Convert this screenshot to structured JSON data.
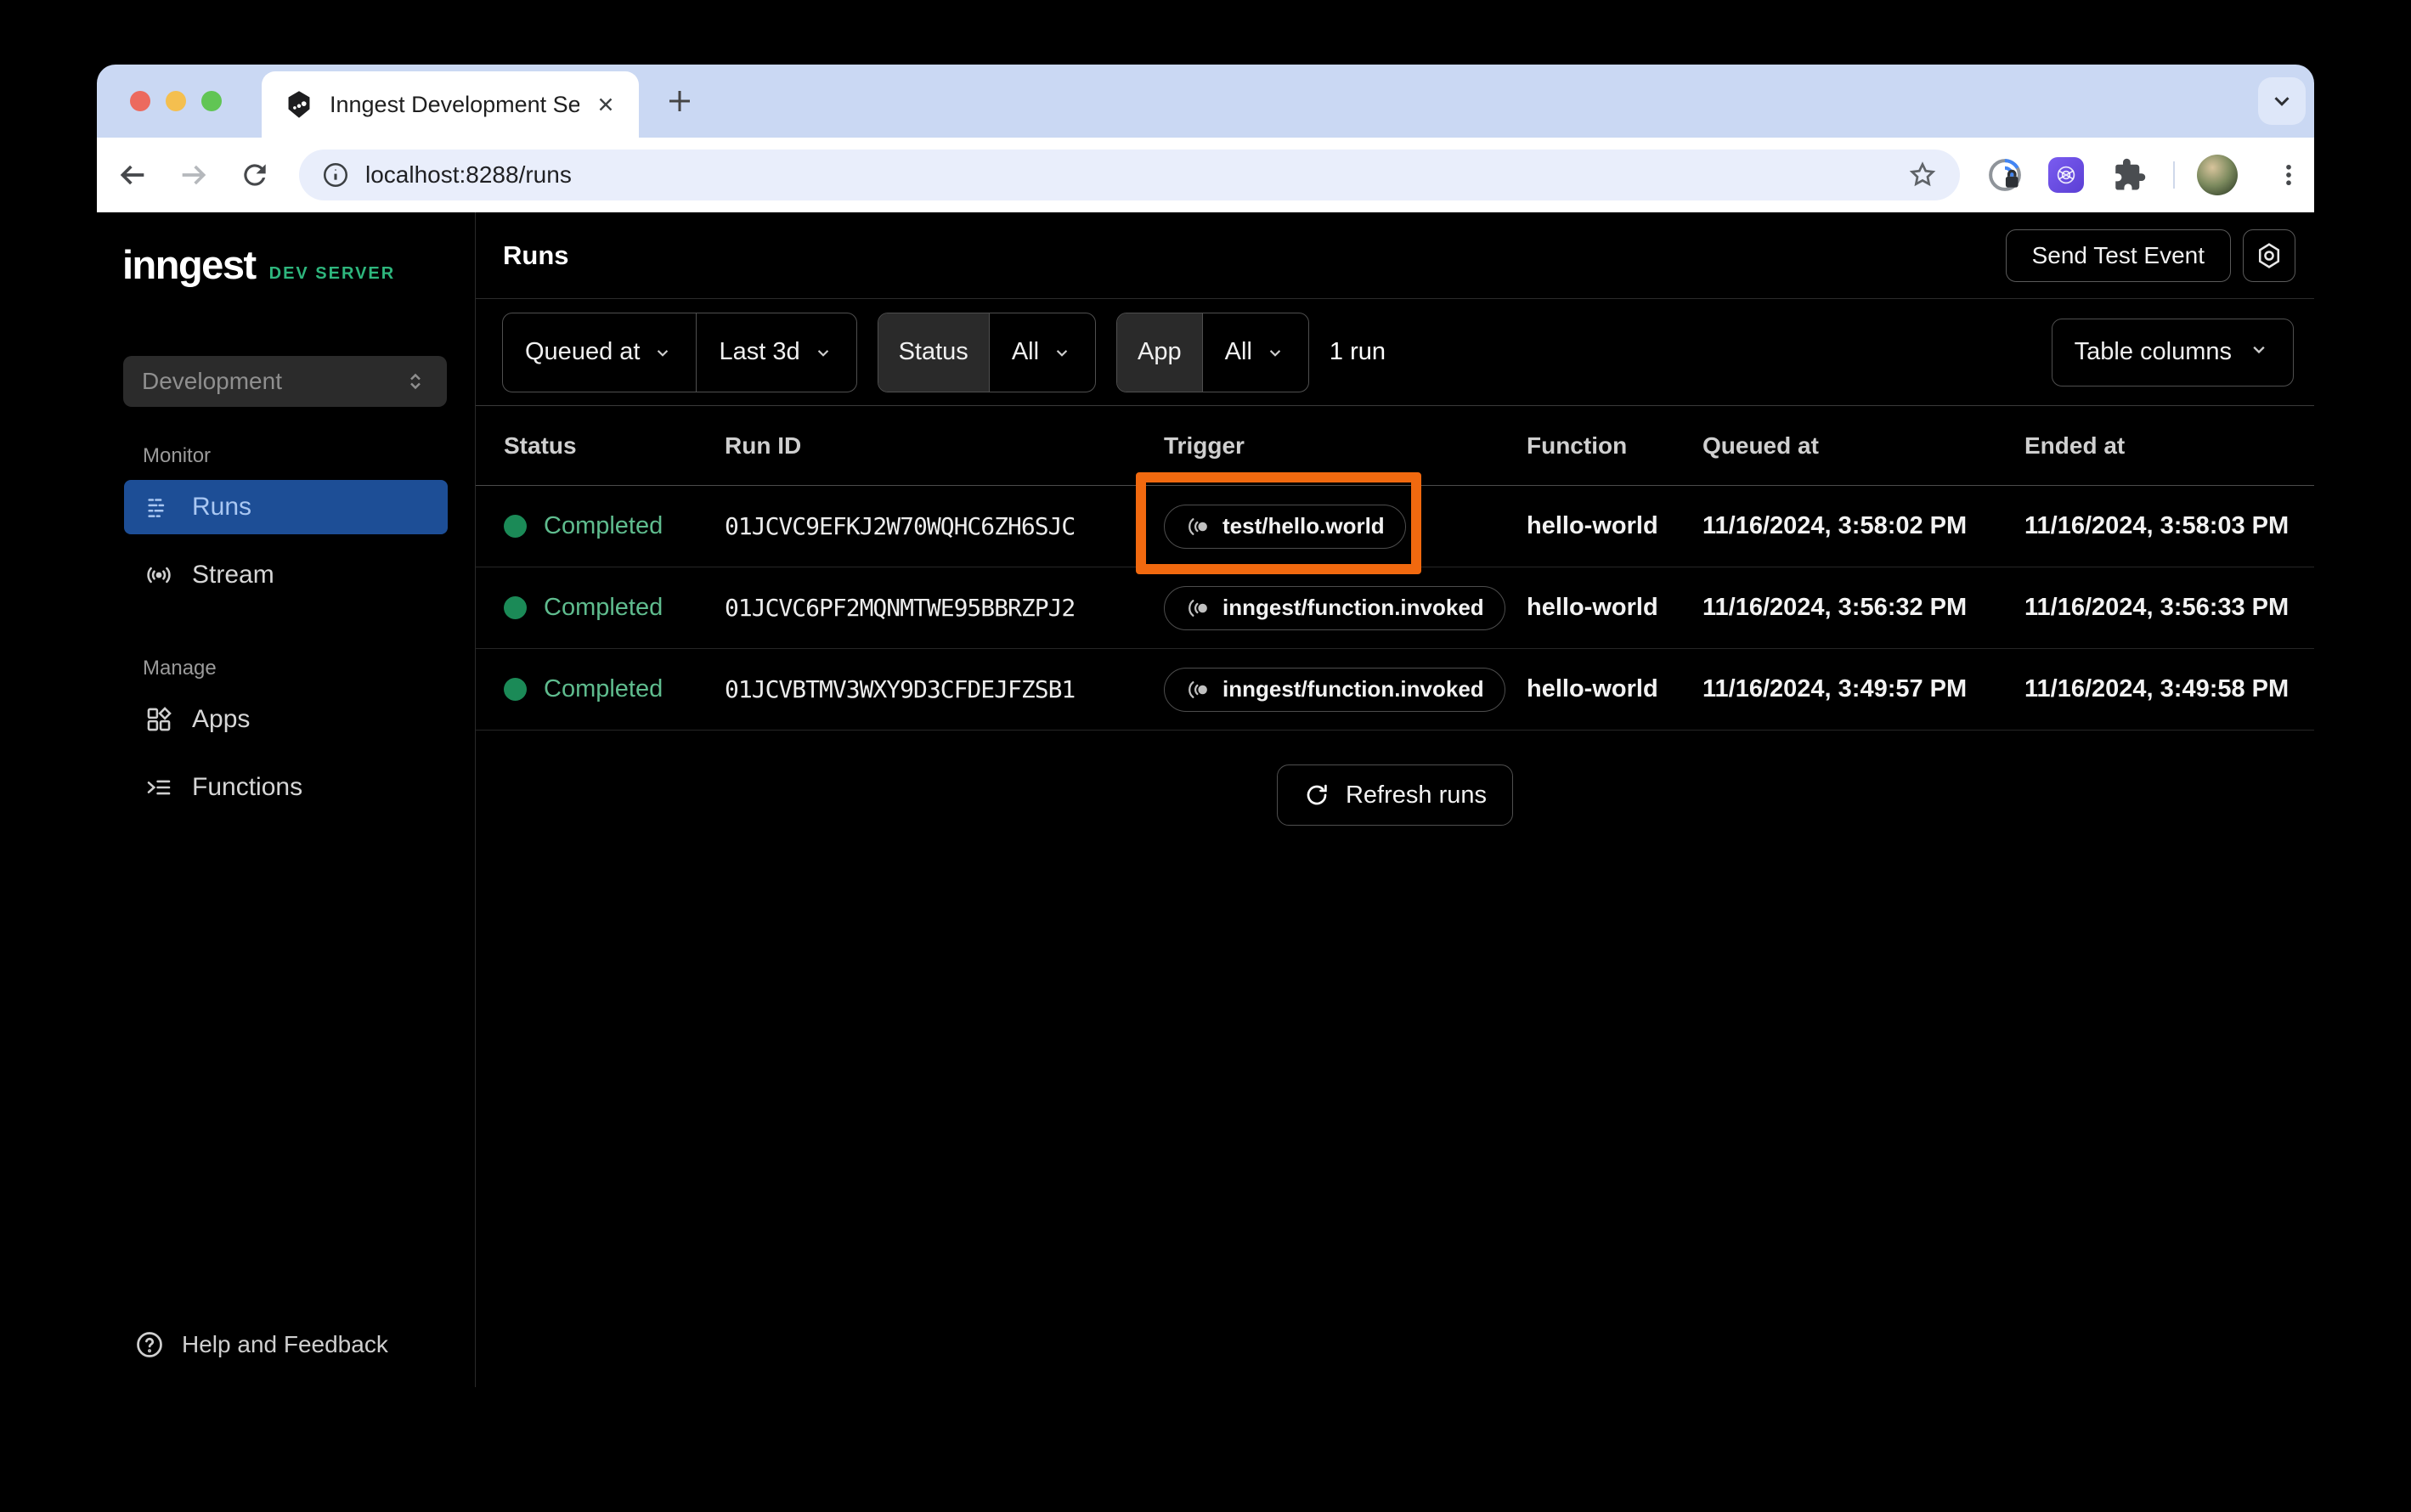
{
  "colors": {
    "accent_green": "#2EB67D",
    "selected_blue": "#1D4E96",
    "highlight_orange": "#F1690F",
    "completed_green": "#5FBC8E"
  },
  "browser": {
    "tab_title": "Inngest Development Server",
    "url": "localhost:8288/runs"
  },
  "sidebar": {
    "brand": "inngest",
    "brand_badge": "DEV SERVER",
    "env_select": "Development",
    "sections": [
      {
        "label": "Monitor",
        "items": [
          {
            "label": "Runs"
          },
          {
            "label": "Stream"
          }
        ]
      },
      {
        "label": "Manage",
        "items": [
          {
            "label": "Apps"
          },
          {
            "label": "Functions"
          }
        ]
      }
    ],
    "help": "Help and Feedback"
  },
  "header": {
    "title": "Runs",
    "send_test_event": "Send Test Event"
  },
  "filters": {
    "queued_at": "Queued at",
    "range": "Last 3d",
    "status_label": "Status",
    "status_value": "All",
    "app_label": "App",
    "app_value": "All",
    "count": "1 run",
    "table_columns": "Table columns"
  },
  "table": {
    "columns": [
      "Status",
      "Run ID",
      "Trigger",
      "Function",
      "Queued at",
      "Ended at"
    ],
    "rows": [
      {
        "status": "Completed",
        "run_id": "01JCVC9EFKJ2W70WQHC6ZH6SJC",
        "trigger": "test/hello.world",
        "function": "hello-world",
        "queued_at": "11/16/2024, 3:58:02 PM",
        "ended_at": "11/16/2024, 3:58:03 PM"
      },
      {
        "status": "Completed",
        "run_id": "01JCVC6PF2MQNMTWE95BBRZPJ2",
        "trigger": "inngest/function.invoked",
        "function": "hello-world",
        "queued_at": "11/16/2024, 3:56:32 PM",
        "ended_at": "11/16/2024, 3:56:33 PM"
      },
      {
        "status": "Completed",
        "run_id": "01JCVBTMV3WXY9D3CFDEJFZSB1",
        "trigger": "inngest/function.invoked",
        "function": "hello-world",
        "queued_at": "11/16/2024, 3:49:57 PM",
        "ended_at": "11/16/2024, 3:49:58 PM"
      }
    ],
    "refresh": "Refresh runs"
  }
}
